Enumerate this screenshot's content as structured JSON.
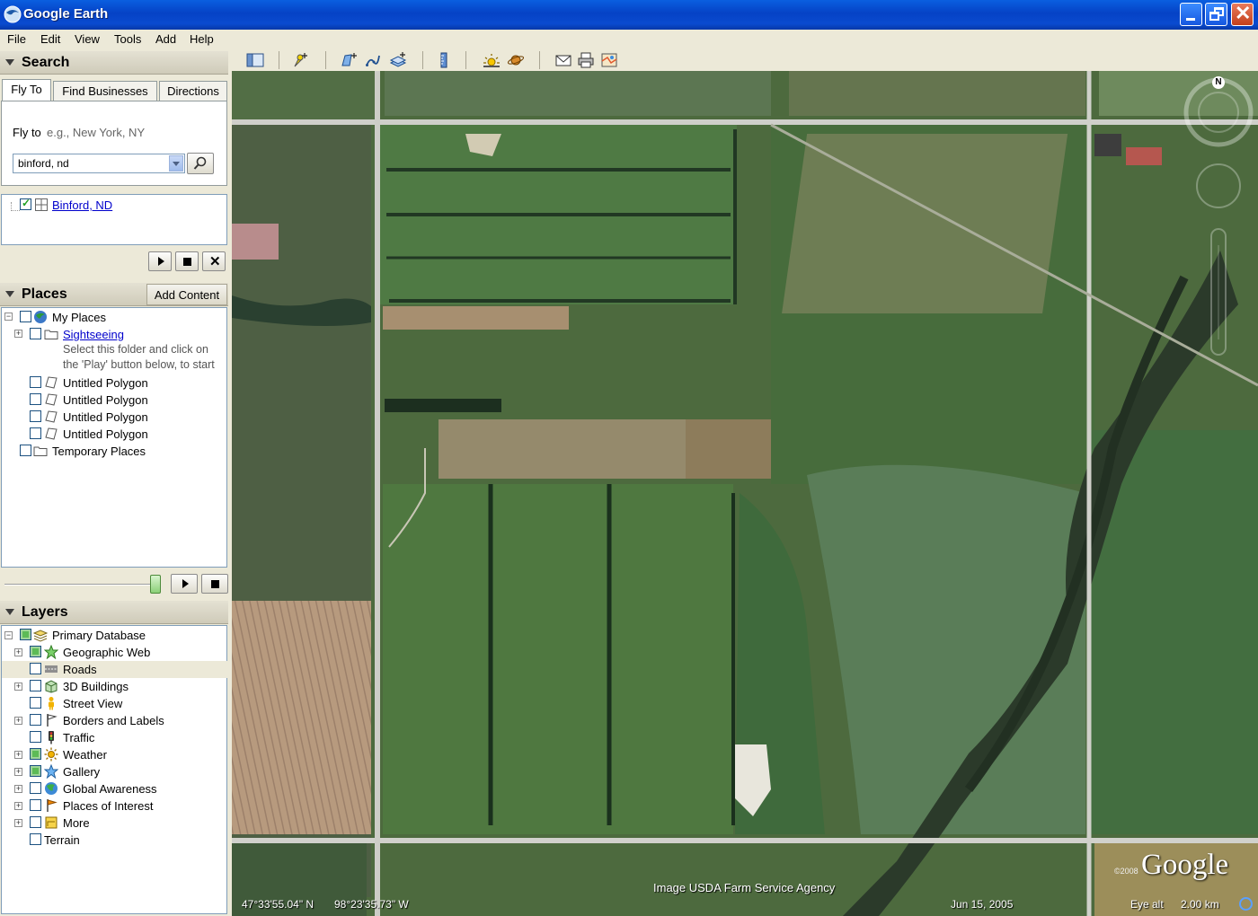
{
  "window": {
    "title": "Google Earth"
  },
  "menu": [
    "File",
    "Edit",
    "View",
    "Tools",
    "Add",
    "Help"
  ],
  "search": {
    "header": "Search",
    "tabs": [
      "Fly To",
      "Find Businesses",
      "Directions"
    ],
    "fly_to_label": "Fly to",
    "fly_to_hint": "e.g., New York, NY",
    "query": "binford, nd",
    "result": "Binford, ND"
  },
  "places": {
    "header": "Places",
    "add_content": "Add Content",
    "items": [
      {
        "label": "My Places"
      },
      {
        "label": "Sightseeing"
      },
      {
        "label": "Select this folder and click on"
      },
      {
        "label": "the 'Play' button below, to start"
      },
      {
        "label": "Untitled Polygon"
      },
      {
        "label": "Untitled Polygon"
      },
      {
        "label": "Untitled Polygon"
      },
      {
        "label": "Untitled Polygon"
      },
      {
        "label": "Temporary Places"
      }
    ]
  },
  "layers": {
    "header": "Layers",
    "items": [
      {
        "label": "Primary Database"
      },
      {
        "label": "Geographic Web"
      },
      {
        "label": "Roads"
      },
      {
        "label": "3D Buildings"
      },
      {
        "label": "Street View"
      },
      {
        "label": "Borders and Labels"
      },
      {
        "label": "Traffic"
      },
      {
        "label": "Weather"
      },
      {
        "label": "Gallery"
      },
      {
        "label": "Global Awareness"
      },
      {
        "label": "Places of Interest"
      },
      {
        "label": "More"
      },
      {
        "label": "Terrain"
      }
    ]
  },
  "map": {
    "latitude": "47°33'55.04\" N",
    "longitude": "98°23'35.73\" W",
    "credit": "Image USDA Farm Service Agency",
    "date": "Jun 15, 2005",
    "eye_alt_label": "Eye alt",
    "eye_alt": "2.00 km",
    "copyright": "©2008",
    "logo": "Google",
    "compass_north": "N"
  },
  "colors": {
    "titlebar": "#0a4bd0",
    "panel": "#ece9d8",
    "link": "#0000cc"
  }
}
